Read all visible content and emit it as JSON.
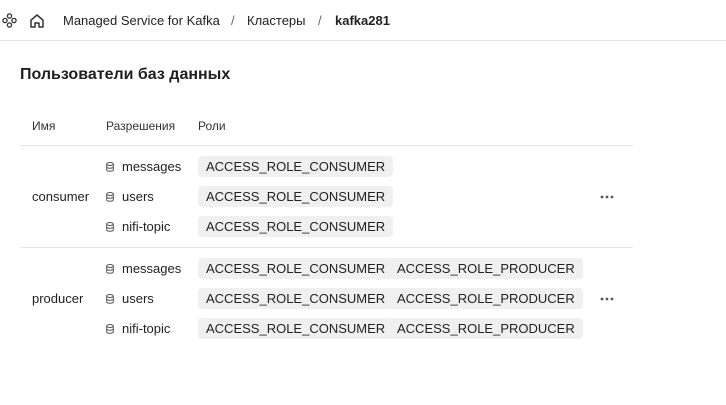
{
  "breadcrumbs": [
    {
      "label": "Managed Service for Kafka"
    },
    {
      "label": "Кластеры"
    },
    {
      "label": "kafka281"
    }
  ],
  "breadcrumb_separator": "/",
  "icons": {
    "services": "services-icon",
    "home": "home-icon",
    "database": "database-icon",
    "more": "more-icon"
  },
  "page": {
    "title": "Пользователи баз данных"
  },
  "table": {
    "columns": {
      "name": "Имя",
      "permissions": "Разрешения",
      "roles": "Роли"
    },
    "rows": [
      {
        "user": "consumer",
        "permissions": [
          {
            "topic": "messages",
            "roles": [
              "ACCESS_ROLE_CONSUMER"
            ]
          },
          {
            "topic": "users",
            "roles": [
              "ACCESS_ROLE_CONSUMER"
            ]
          },
          {
            "topic": "nifi-topic",
            "roles": [
              "ACCESS_ROLE_CONSUMER"
            ]
          }
        ]
      },
      {
        "user": "producer",
        "permissions": [
          {
            "topic": "messages",
            "roles": [
              "ACCESS_ROLE_CONSUMER",
              "ACCESS_ROLE_PRODUCER"
            ]
          },
          {
            "topic": "users",
            "roles": [
              "ACCESS_ROLE_CONSUMER",
              "ACCESS_ROLE_PRODUCER"
            ]
          },
          {
            "topic": "nifi-topic",
            "roles": [
              "ACCESS_ROLE_CONSUMER",
              "ACCESS_ROLE_PRODUCER"
            ]
          }
        ]
      }
    ]
  }
}
